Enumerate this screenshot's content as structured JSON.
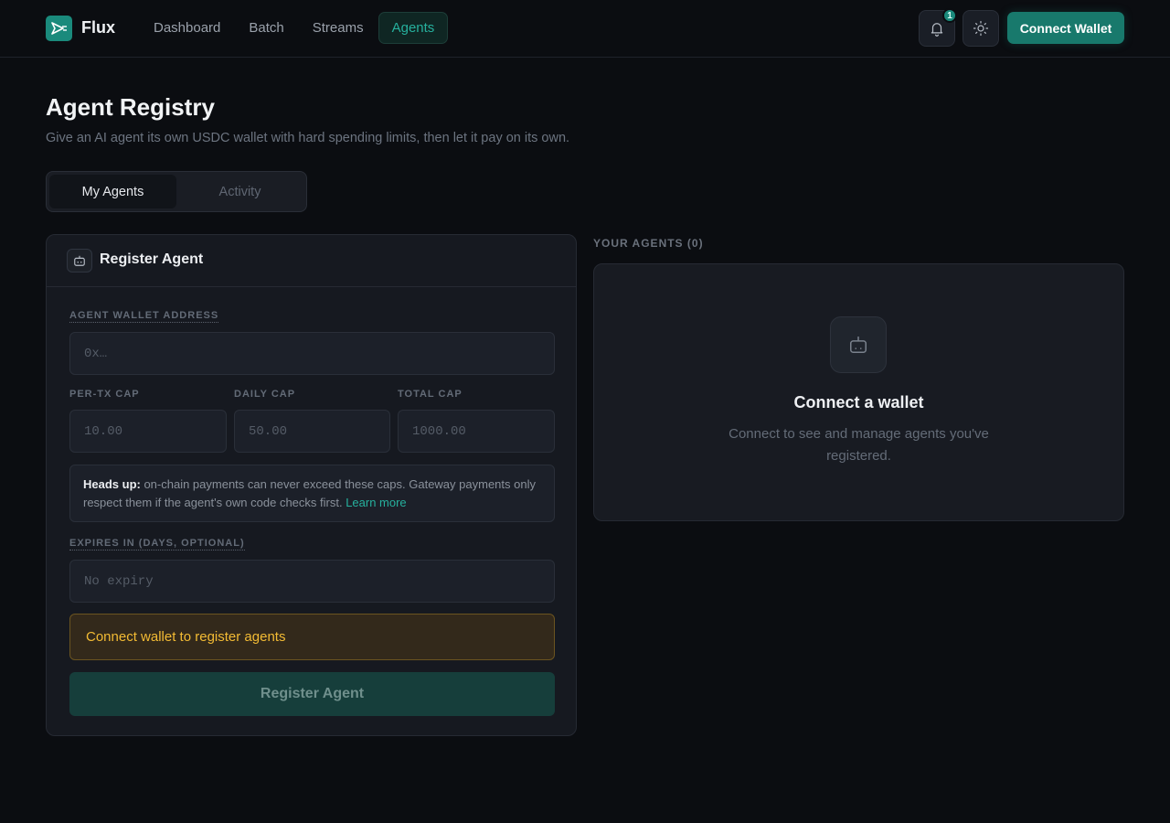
{
  "app": {
    "name": "Flux"
  },
  "nav": {
    "items": [
      {
        "label": "Dashboard",
        "active": false
      },
      {
        "label": "Batch",
        "active": false
      },
      {
        "label": "Streams",
        "active": false
      },
      {
        "label": "Agents",
        "active": true
      }
    ]
  },
  "header": {
    "notifications_count": "1",
    "connect_label": "Connect Wallet"
  },
  "page": {
    "title": "Agent Registry",
    "subtitle": "Give an AI agent its own USDC wallet with hard spending limits, then let it pay on its own."
  },
  "tabs": [
    {
      "label": "My Agents",
      "active": true
    },
    {
      "label": "Activity",
      "active": false
    }
  ],
  "form": {
    "title": "Register Agent",
    "address_label": "Agent wallet address",
    "address_placeholder": "0x…",
    "per_tx_label": "Per-tx cap",
    "per_tx_placeholder": "10.00",
    "daily_label": "Daily cap",
    "daily_placeholder": "50.00",
    "total_label": "Total cap",
    "total_placeholder": "1000.00",
    "note_bold": "Heads up:",
    "note_text": " on-chain payments can never exceed these caps. Gateway payments only respect them if the agent's own code checks first. ",
    "note_link": "Learn more",
    "expires_label": "Expires in (days, optional)",
    "expires_placeholder": "No expiry",
    "warning": "Connect wallet to register agents",
    "submit_label": "Register Agent"
  },
  "agents": {
    "heading": "YOUR AGENTS (0)",
    "empty_title": "Connect a wallet",
    "empty_text": "Connect to see and manage agents you've registered."
  },
  "colors": {
    "accent": "#1a8a7c",
    "accent_text": "#26b09d",
    "warning": "#f3bb34",
    "background": "#0b0d11"
  }
}
